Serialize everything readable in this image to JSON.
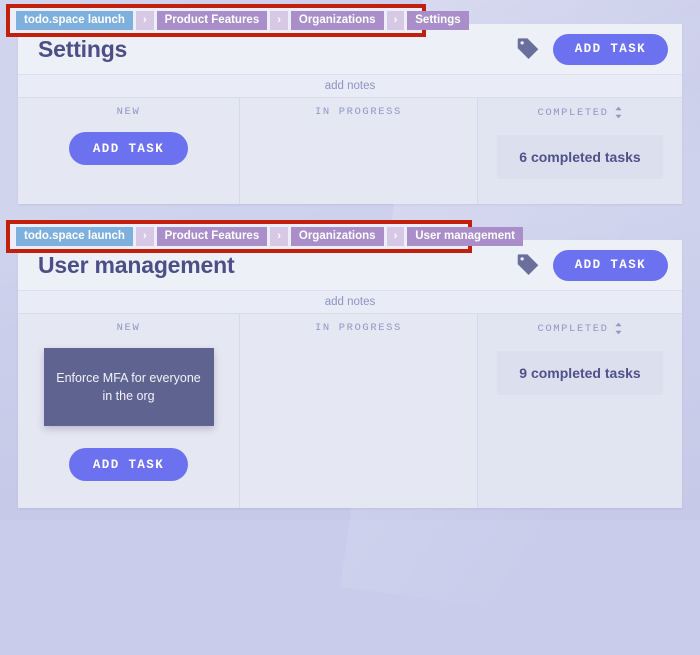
{
  "page": {
    "background_color": "#c9cdeb",
    "accent_color": "#6c71f0",
    "annotation_color": "#c21f0d"
  },
  "breadcrumbs": [
    {
      "name": "settings-breadcrumb",
      "separator": "›",
      "items": [
        {
          "label": "todo.space launch",
          "kind": "root"
        },
        {
          "label": "Product Features",
          "kind": "mid"
        },
        {
          "label": "Organizations",
          "kind": "mid"
        },
        {
          "label": "Settings",
          "kind": "leaf"
        }
      ]
    },
    {
      "name": "user-management-breadcrumb",
      "separator": "›",
      "items": [
        {
          "label": "todo.space launch",
          "kind": "root"
        },
        {
          "label": "Product Features",
          "kind": "mid"
        },
        {
          "label": "Organizations",
          "kind": "mid"
        },
        {
          "label": "User management",
          "kind": "leaf"
        }
      ]
    }
  ],
  "boards": [
    {
      "title": "Settings",
      "tag_icon": "tag-icon",
      "add_task_label": "ADD TASK",
      "notes_label": "add notes",
      "columns": {
        "new": {
          "title": "NEW",
          "add_task_label": "ADD TASK",
          "cards": []
        },
        "in_progress": {
          "title": "IN PROGRESS",
          "cards": []
        },
        "completed": {
          "title": "COMPLETED",
          "sort_icon": "sort-chevrons-icon",
          "summary": "6 completed tasks",
          "count": 6
        }
      }
    },
    {
      "title": "User management",
      "tag_icon": "tag-icon",
      "add_task_label": "ADD TASK",
      "notes_label": "add notes",
      "columns": {
        "new": {
          "title": "NEW",
          "add_task_label": "ADD TASK",
          "cards": [
            {
              "text": "Enforce MFA for everyone in the org"
            }
          ]
        },
        "in_progress": {
          "title": "IN PROGRESS",
          "cards": []
        },
        "completed": {
          "title": "COMPLETED",
          "sort_icon": "sort-chevrons-icon",
          "summary": "9 completed tasks",
          "count": 9
        }
      }
    }
  ]
}
